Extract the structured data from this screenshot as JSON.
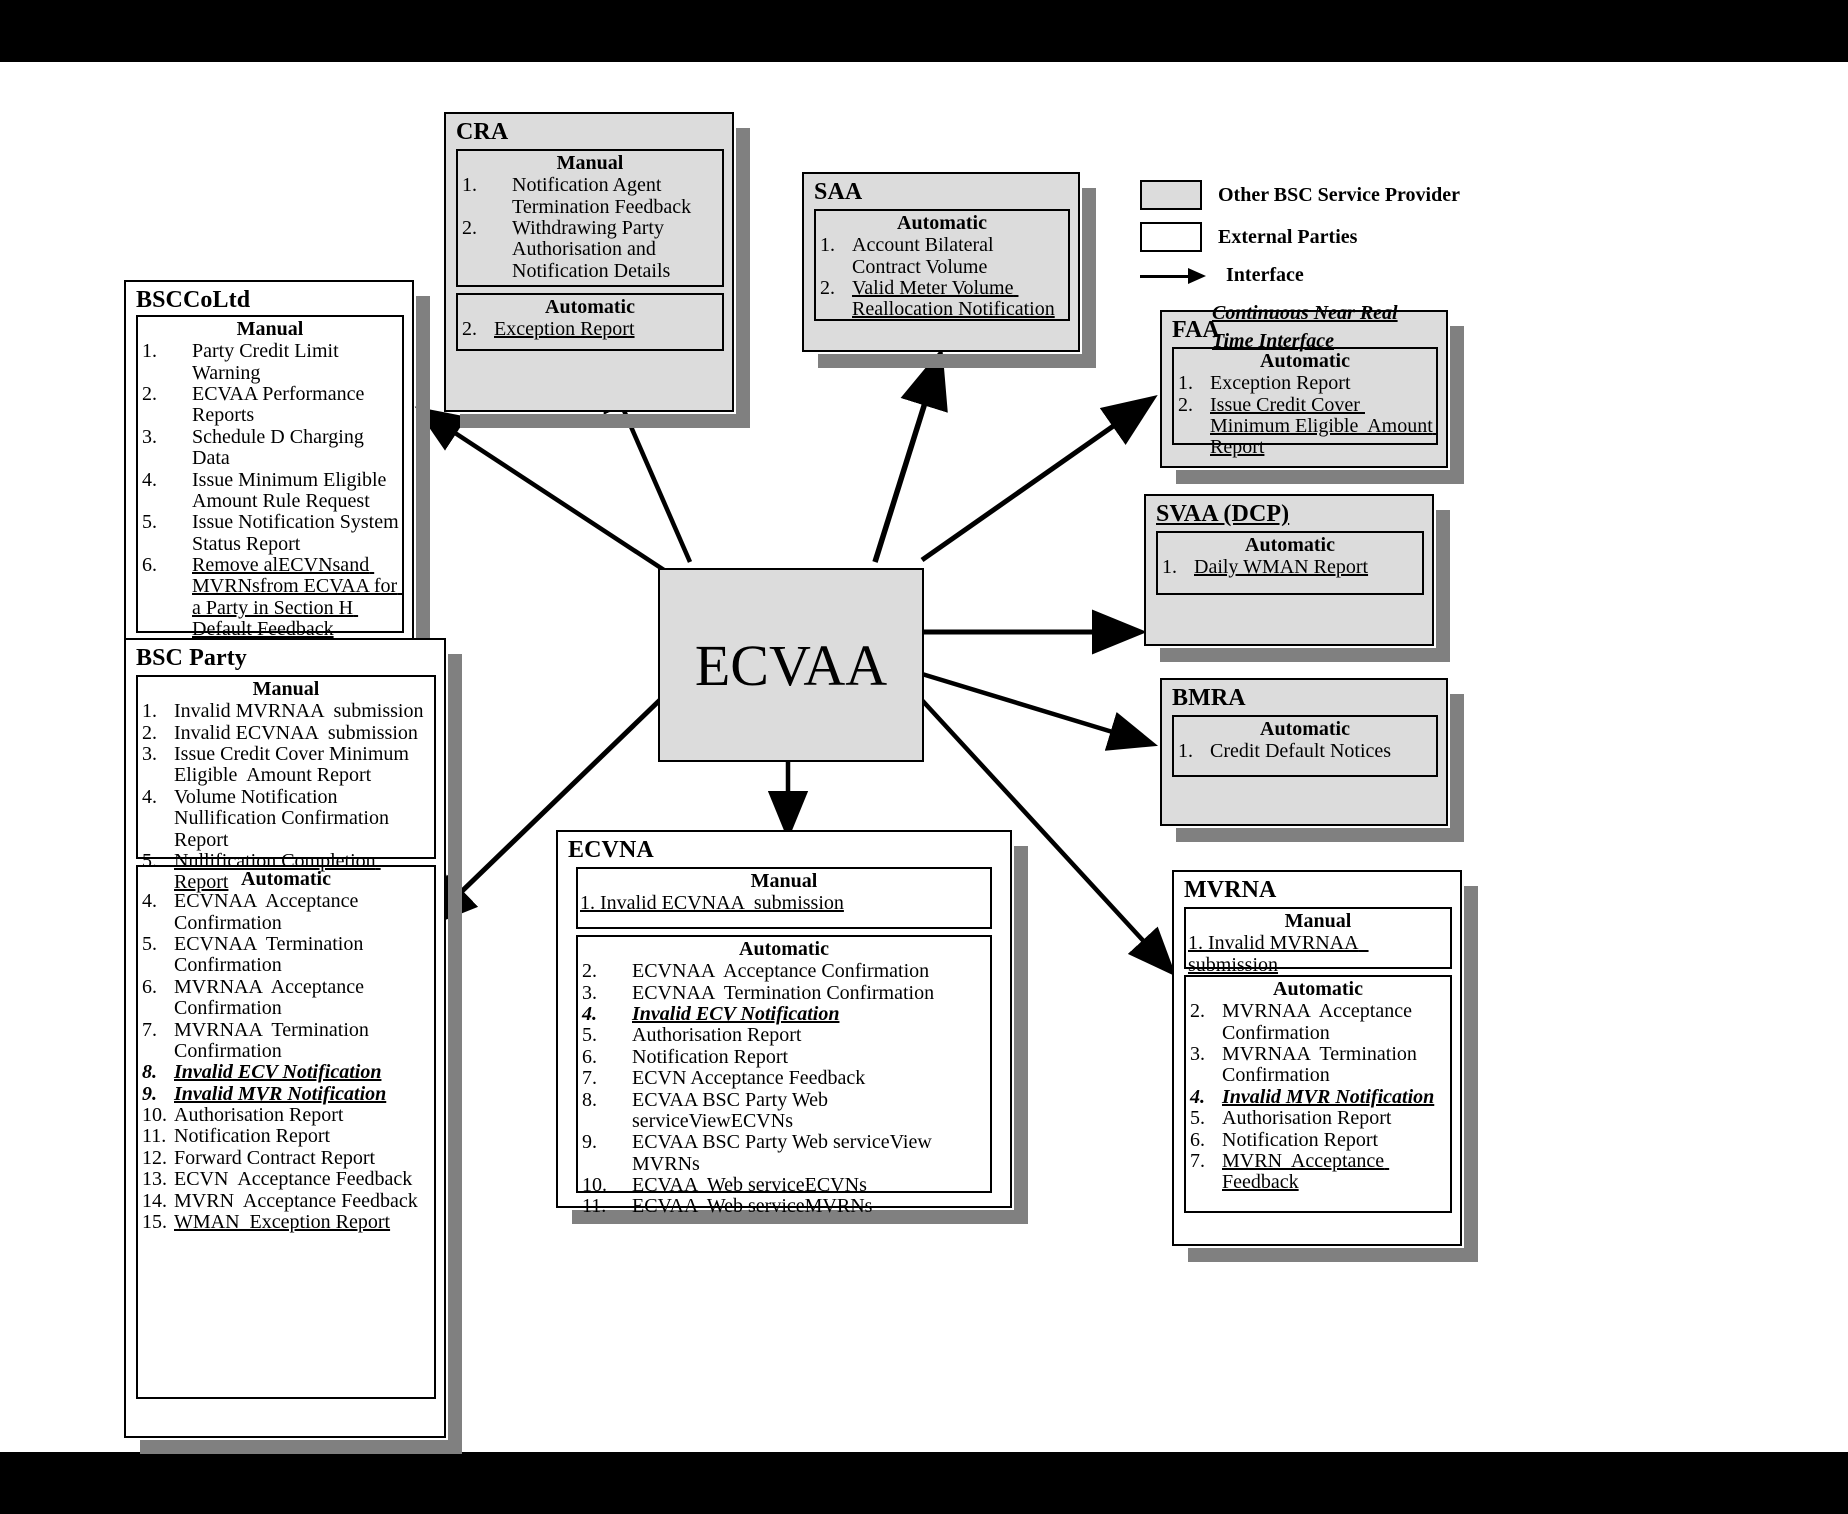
{
  "center": {
    "label": "ECVAA"
  },
  "legend": {
    "other_provider": "Other BSC Service Provider",
    "external_parties": "External Parties",
    "interface": "Interface",
    "continuous_line1": "Continuous Near Real",
    "continuous_line2": "Time Interface",
    "colors": {
      "provider_fill": "#dcdcdc",
      "external_fill": "#ffffff",
      "line": "#000000",
      "shadow": "#808080"
    }
  },
  "nodes": {
    "bsccoltd": {
      "title": "BSCCoLtd",
      "sections": [
        {
          "head": "Manual",
          "items": [
            {
              "num": "1.",
              "text": "Party Credit Limit Warning"
            },
            {
              "num": "2.",
              "text": "ECVAA Performance Reports"
            },
            {
              "num": "3.",
              "text": "Schedule D Charging Data"
            },
            {
              "num": "4.",
              "text": "Issue Minimum Eligible Amount Rule Request"
            },
            {
              "num": "5.",
              "text": "Issue Notification System Status Report"
            },
            {
              "num": "6.",
              "text": "Remove alECVNsand MVRNsfrom ECVAA for a Party in Section H Default Feedback"
            }
          ]
        }
      ]
    },
    "cra": {
      "title": "CRA",
      "sections": [
        {
          "head": "Manual",
          "items": [
            {
              "num": "1.",
              "text": "Notification Agent Termination Feedback"
            },
            {
              "num": "2.",
              "text": "Withdrawing Party Authorisation and Notification Details"
            }
          ]
        },
        {
          "head": "Automatic",
          "items": [
            {
              "num": "2.",
              "text": "Exception Report"
            }
          ]
        }
      ]
    },
    "saa": {
      "title": "SAA",
      "sections": [
        {
          "head": "Automatic",
          "items": [
            {
              "num": "1.",
              "text": "Account Bilateral  Contract Volume"
            },
            {
              "num": "2.",
              "text": "Valid Meter Volume Reallocation Notification"
            }
          ]
        }
      ]
    },
    "faa": {
      "title": "FAA",
      "sections": [
        {
          "head": "Automatic",
          "items": [
            {
              "num": "1.",
              "text": "Exception Report"
            },
            {
              "num": "2.",
              "text": "Issue Credit Cover Minimum Eligible  Amount Report"
            }
          ]
        }
      ]
    },
    "svaa": {
      "title": "SVAA (DCP)",
      "sections": [
        {
          "head": "Automatic",
          "items": [
            {
              "num": "1.",
              "text": "Daily WMAN Report"
            }
          ]
        }
      ]
    },
    "bmra": {
      "title": "BMRA",
      "sections": [
        {
          "head": "Automatic",
          "items": [
            {
              "num": "1.",
              "text": "Credit Default Notices"
            }
          ]
        }
      ]
    },
    "bscparty": {
      "title": "BSC Party",
      "sections": [
        {
          "head": "Manual",
          "items": [
            {
              "num": "1.",
              "text": "Invalid MVRNAA  submission"
            },
            {
              "num": "2.",
              "text": "Invalid ECVNAA  submission"
            },
            {
              "num": "3.",
              "text": "Issue Credit Cover Minimum Eligible  Amount Report"
            },
            {
              "num": "4.",
              "text": "Volume Notification Nullification Confirmation Report"
            },
            {
              "num": "5.",
              "text": "Nullification Completion Report"
            }
          ]
        },
        {
          "head": "Automatic",
          "items": [
            {
              "num": "4.",
              "text": "ECVNAA  Acceptance Confirmation"
            },
            {
              "num": "5.",
              "text": "ECVNAA  Termination Confirmation"
            },
            {
              "num": "6.",
              "text": "MVRNAA  Acceptance Confirmation"
            },
            {
              "num": "7.",
              "text": "MVRNAA  Termination Confirmation"
            },
            {
              "num": "8.",
              "text": "Invalid ECV Notification"
            },
            {
              "num": "9.",
              "text": "Invalid MVR Notification"
            },
            {
              "num": "10.",
              "text": "Authorisation Report"
            },
            {
              "num": "11.",
              "text": "Notification Report"
            },
            {
              "num": "12.",
              "text": "Forward Contract Report"
            },
            {
              "num": "13.",
              "text": "ECVN  Acceptance Feedback"
            },
            {
              "num": "14.",
              "text": "MVRN  Acceptance Feedback"
            },
            {
              "num": "15.",
              "text": "WMAN  Exception Report"
            }
          ]
        }
      ]
    },
    "ecvna": {
      "title": "ECVNA",
      "sections": [
        {
          "head": "Manual",
          "items": [
            {
              "num": "1.",
              "text": "Invalid ECVNAA  submission"
            }
          ]
        },
        {
          "head": "Automatic",
          "items": [
            {
              "num": "2.",
              "text": "ECVNAA  Acceptance Confirmation"
            },
            {
              "num": "3.",
              "text": "ECVNAA  Termination Confirmation"
            },
            {
              "num": "4.",
              "text": "Invalid ECV Notification"
            },
            {
              "num": "5.",
              "text": "Authorisation Report"
            },
            {
              "num": "6.",
              "text": "Notification Report"
            },
            {
              "num": "7.",
              "text": "ECVN Acceptance Feedback"
            },
            {
              "num": "8.",
              "text": "ECVAA BSC Party Web serviceViewECVNs"
            },
            {
              "num": "9.",
              "text": "ECVAA BSC Party Web serviceView MVRNs"
            },
            {
              "num": "10.",
              "text": "ECVAA  Web serviceECVNs"
            },
            {
              "num": "11.",
              "text": "ECVAA  Web serviceMVRNs"
            }
          ]
        }
      ]
    },
    "mvrna": {
      "title": "MVRNA",
      "sections": [
        {
          "head": "Manual",
          "items": [
            {
              "num": "1.",
              "text": "Invalid MVRNAA  submission"
            }
          ]
        },
        {
          "head": "Automatic",
          "items": [
            {
              "num": "2.",
              "text": "MVRNAA  Acceptance Confirmation"
            },
            {
              "num": "3.",
              "text": "MVRNAA  Termination Confirmation"
            },
            {
              "num": "4.",
              "text": "Invalid MVR Notification"
            },
            {
              "num": "5.",
              "text": "Authorisation Report"
            },
            {
              "num": "6.",
              "text": "Notification Report"
            },
            {
              "num": "7.",
              "text": "MVRN  Acceptance Feedback"
            }
          ]
        }
      ]
    }
  }
}
